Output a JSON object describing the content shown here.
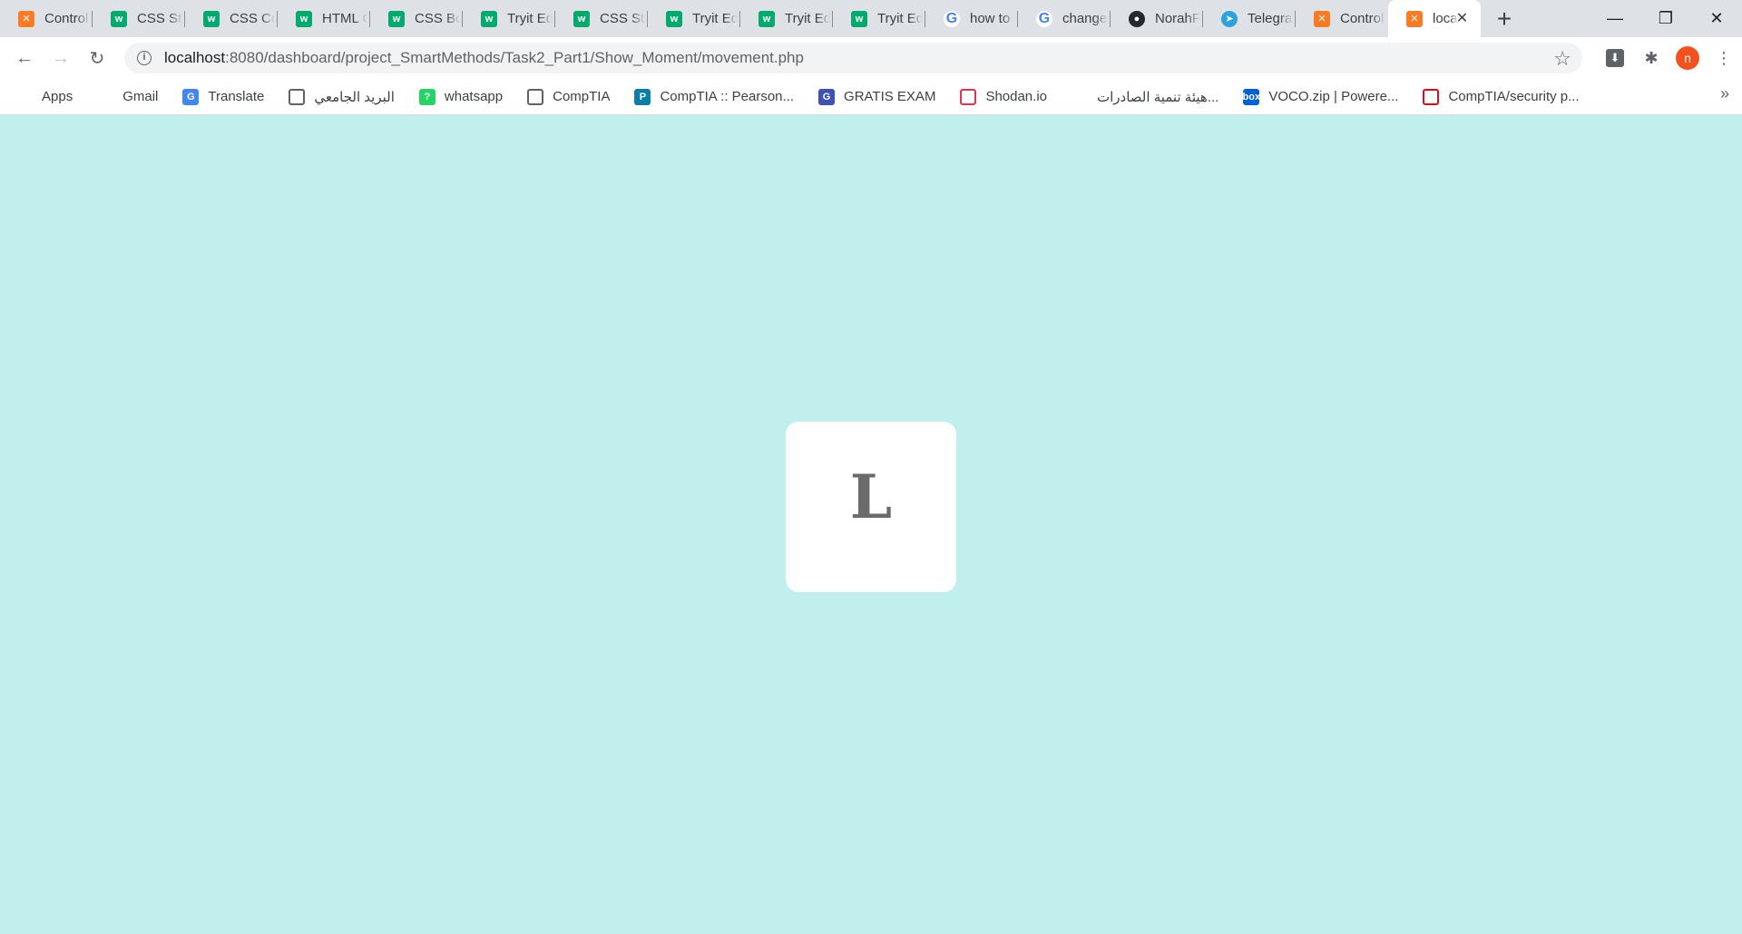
{
  "browser": {
    "tabs": [
      {
        "title": "Control",
        "icon": "xampp-icon"
      },
      {
        "title": "CSS Styl",
        "icon": "w3schools-icon"
      },
      {
        "title": "CSS Col",
        "icon": "w3schools-icon"
      },
      {
        "title": "HTML C",
        "icon": "w3schools-icon"
      },
      {
        "title": "CSS Bor",
        "icon": "w3schools-icon"
      },
      {
        "title": "Tryit Edi",
        "icon": "w3schools-icon"
      },
      {
        "title": "CSS Styl",
        "icon": "w3schools-icon"
      },
      {
        "title": "Tryit Edi",
        "icon": "w3schools-icon"
      },
      {
        "title": "Tryit Edi",
        "icon": "w3schools-icon"
      },
      {
        "title": "Tryit Edi",
        "icon": "w3schools-icon"
      },
      {
        "title": "how to",
        "icon": "google-icon"
      },
      {
        "title": "change",
        "icon": "google-icon"
      },
      {
        "title": "NorahF",
        "icon": "github-icon"
      },
      {
        "title": "Telegra",
        "icon": "telegram-icon"
      },
      {
        "title": "Control",
        "icon": "xampp-icon"
      },
      {
        "title": "loca",
        "icon": "xampp-icon",
        "active": true
      }
    ],
    "url": {
      "host": "localhost",
      "path": ":8080/dashboard/project_SmartMethods/Task2_Part1/Show_Moment/movement.php"
    },
    "profile_initial": "n",
    "bookmarks": [
      {
        "label": "Apps",
        "icon": "apps-grid-icon"
      },
      {
        "label": "Gmail",
        "icon": "gmail-icon"
      },
      {
        "label": "Translate",
        "icon": "google-translate-icon"
      },
      {
        "label": "البريد الجامعي",
        "icon": "globe-icon"
      },
      {
        "label": "whatsapp",
        "icon": "whatsapp-icon"
      },
      {
        "label": "CompTIA",
        "icon": "globe-icon"
      },
      {
        "label": "CompTIA :: Pearson...",
        "icon": "pearson-icon"
      },
      {
        "label": "GRATIS EXAM",
        "icon": "gratis-exam-icon"
      },
      {
        "label": "Shodan.io",
        "icon": "shodan-icon"
      },
      {
        "label": "هيئة تنمية الصادرات...",
        "icon": "export-authority-icon"
      },
      {
        "label": "VOCO.zip | Powere...",
        "icon": "box-icon"
      },
      {
        "label": "CompTIA/security p...",
        "icon": "comptia-security-icon"
      }
    ],
    "colors": {
      "tabstrip": "#dee1e6",
      "toolbar": "#ffffff",
      "omnibox": "#f1f3f4",
      "profile": "#f4511e"
    }
  },
  "page": {
    "background": "#c0efee",
    "card": {
      "letter": "L",
      "background": "#ffffff",
      "letter_color": "#6b6b6b"
    }
  }
}
